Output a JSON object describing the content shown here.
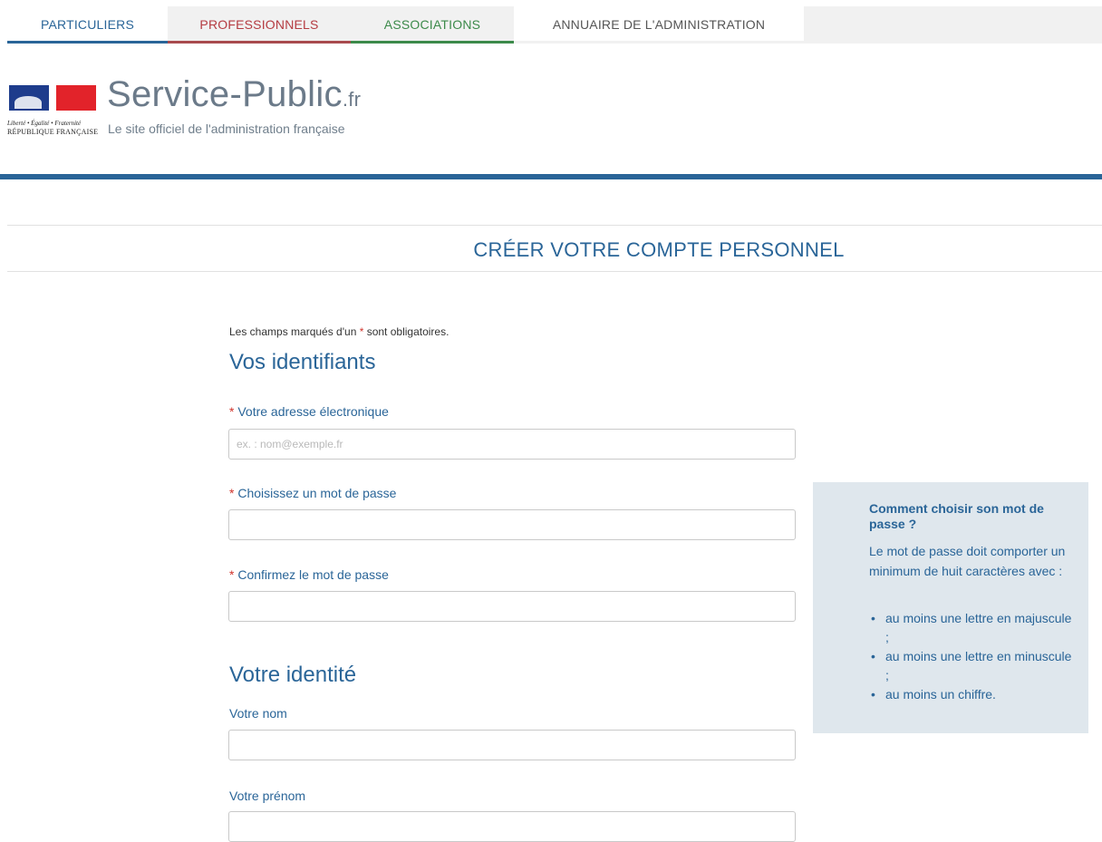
{
  "topnav": {
    "tabs": [
      {
        "label": "PARTICULIERS"
      },
      {
        "label": "PROFESSIONNELS"
      },
      {
        "label": "ASSOCIATIONS"
      },
      {
        "label": "ANNUAIRE DE L'ADMINISTRATION"
      }
    ]
  },
  "brand": {
    "motto": "Liberté • Égalité • Fraternité",
    "republique": "RÉPUBLIQUE FRANÇAISE",
    "name": "Service-Public",
    "tld": ".fr",
    "tagline": "Le site officiel de l'administration française"
  },
  "page": {
    "title": "CRÉER VOTRE COMPTE PERSONNEL"
  },
  "form": {
    "required_note_prefix": "Les champs marqués d'un ",
    "required_star": "*",
    "required_note_suffix": " sont obligatoires.",
    "sections": {
      "identifiants": "Vos identifiants",
      "identite": "Votre identité"
    },
    "fields": {
      "email": {
        "label": "Votre adresse électronique",
        "placeholder": "ex. : nom@exemple.fr",
        "value": ""
      },
      "password": {
        "label": "Choisissez un mot de passe",
        "value": ""
      },
      "confirm": {
        "label": "Confirmez le mot de passe",
        "value": ""
      },
      "nom": {
        "label": "Votre nom",
        "value": ""
      },
      "prenom": {
        "label": "Votre prénom",
        "value": ""
      }
    }
  },
  "help": {
    "title": "Comment choisir son mot de passe ?",
    "text": "Le mot de passe doit comporter un minimum de huit caractères avec :",
    "rules": [
      "au moins une lettre en majuscule ;",
      "au moins une lettre en minuscule ;",
      "au moins un chiffre."
    ]
  },
  "colors": {
    "primary_blue": "#2a6598",
    "pro_red": "#b53c42",
    "assoc_green": "#3c8a4a",
    "help_bg": "#dfe7ed",
    "required_red": "#d0342c"
  }
}
